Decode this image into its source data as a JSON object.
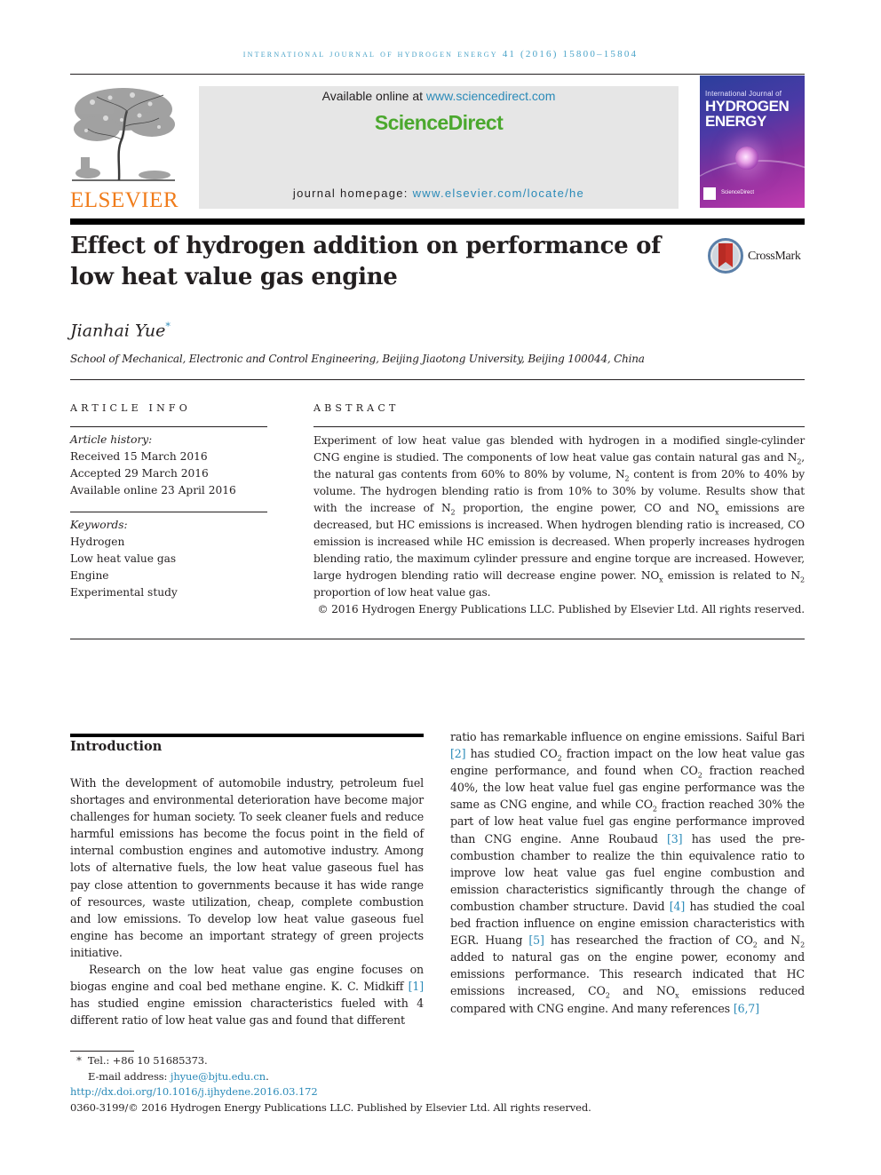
{
  "running_header": "International Journal of Hydrogen Energy 41 (2016) 15800–15804",
  "header": {
    "publisher_logo_text": "ELSEVIER",
    "available_online_prefix": "Available online at ",
    "available_online_link": "www.sciencedirect.com",
    "sciencedirect_logo": "ScienceDirect",
    "homepage_prefix": "journal homepage: ",
    "homepage_link": "www.elsevier.com/locate/he",
    "cover": {
      "small_title": "International Journal of",
      "big_title_line1": "HYDROGEN",
      "big_title_line2": "ENERGY",
      "footer": "ScienceDirect"
    }
  },
  "article": {
    "title": "Effect of hydrogen addition on performance of low heat value gas engine",
    "crossmark_label": "CrossMark",
    "author": "Jianhai Yue",
    "author_marker": "*",
    "affiliation": "School of Mechanical, Electronic and Control Engineering, Beijing Jiaotong University, Beijing 100044, China"
  },
  "article_info": {
    "heading": "ARTICLE INFO",
    "history_label": "Article history:",
    "history": [
      "Received 15 March 2016",
      "Accepted 29 March 2016",
      "Available online 23 April 2016"
    ],
    "keywords_label": "Keywords:",
    "keywords": [
      "Hydrogen",
      "Low heat value gas",
      "Engine",
      "Experimental study"
    ]
  },
  "abstract": {
    "heading": "ABSTRACT",
    "parts": {
      "p1": "Experiment of low heat value gas blended with hydrogen in a modified single-cylinder CNG engine is studied. The components of low heat value gas contain natural gas and N",
      "p2": ", the natural gas contents from 60% to 80% by volume, N",
      "p3": " content is from 20% to 40% by volume. The hydrogen blending ratio is from 10% to 30% by volume. Results show that with the increase of N",
      "p4": " proportion, the engine power, CO and NO",
      "p5": " emissions are decreased, but HC emissions is increased. When hydrogen blending ratio is increased, CO emission is increased while HC emission is decreased. When properly increases hydrogen blending ratio, the maximum cylinder pressure and engine torque are increased. However, large hydrogen blending ratio will decrease engine power. NO",
      "p6": " emission is related to N",
      "p7": " proportion of low heat value gas.",
      "sub_2": "2",
      "sub_x": "x"
    },
    "copyright": "© 2016 Hydrogen Energy Publications LLC. Published by Elsevier Ltd. All rights reserved."
  },
  "introduction": {
    "heading": "Introduction",
    "para1": "With the development of automobile industry, petroleum fuel shortages and environmental deterioration have become major challenges for human society. To seek cleaner fuels and reduce harmful emissions has become the focus point in the field of internal combustion engines and automotive industry. Among lots of alternative fuels, the low heat value gaseous fuel has pay close attention to governments because it has wide range of resources, waste utilization, cheap, complete combustion and low emissions. To develop low heat value gaseous fuel engine has become an important strategy of green projects initiative.",
    "para2_a": "Research on the low heat value gas engine focuses on biogas engine and coal bed methane engine. K. C. Midkiff ",
    "ref1": "[1]",
    "para2_b": " has studied engine emission characteristics fueled with 4 different ratio of low heat value gas and found that different ratio has remarkable influence on engine emissions. Saiful Bari ",
    "ref2": "[2]",
    "para2_c": " has studied CO",
    "para2_d": " fraction impact on the low heat value gas engine performance, and found when CO",
    "para2_e": " fraction reached 40%, the low heat value fuel gas engine performance was the same as CNG engine, and while CO",
    "para2_f": " fraction reached 30% the part of low heat value fuel gas engine performance improved than CNG engine. Anne Roubaud ",
    "ref3": "[3]",
    "para2_g": " has used the pre-combustion chamber to realize the thin equivalence ratio to improve low heat value gas fuel engine combustion and emission characteristics significantly through the change of combustion chamber structure. David ",
    "ref4": "[4]",
    "para2_h": " has studied the coal bed fraction influence on engine emission characteristics with EGR. Huang ",
    "ref5": "[5]",
    "para2_i": " has researched the fraction of CO",
    "para2_j": " and N",
    "para2_k": " added to natural gas on the engine power, economy and emissions performance. This research indicated that HC emissions increased, CO",
    "para2_l": " and NO",
    "para2_m": " emissions reduced compared with CNG engine. And many references ",
    "ref67": "[6,7]",
    "sub_2": "2",
    "sub_x": "x"
  },
  "footnotes": {
    "marker": "*",
    "tel": "Tel.: +86 10 51685373.",
    "email_label": "E-mail address: ",
    "email": "jhyue@bjtu.edu.cn",
    "email_suffix": ".",
    "doi": "http://dx.doi.org/10.1016/j.ijhydene.2016.03.172",
    "issn_line": "0360-3199/© 2016 Hydrogen Energy Publications LLC. Published by Elsevier Ltd. All rights reserved."
  },
  "colors": {
    "link": "#2a8ab8",
    "sciencedirect_green": "#4ba82e",
    "elsevier_orange": "#f07c1b"
  }
}
